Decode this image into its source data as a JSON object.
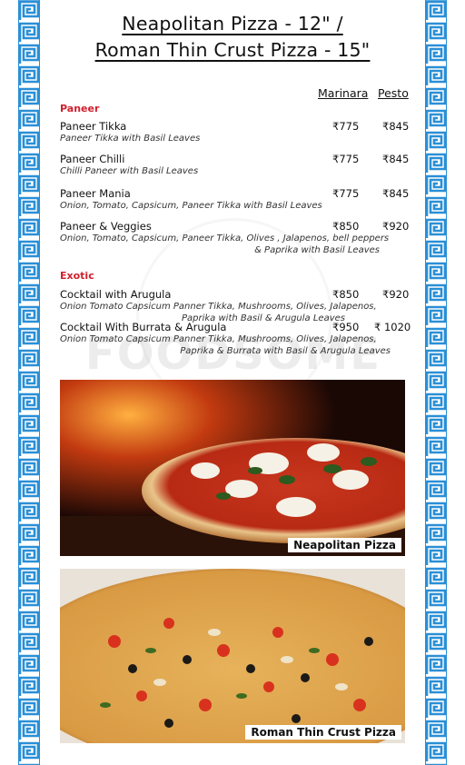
{
  "title_line1": "Neapolitan Pizza - 12\"  /",
  "title_line2": "Roman Thin Crust Pizza - 15\"",
  "columns": {
    "marinara": "Marinara",
    "pesto": "Pesto"
  },
  "sections": [
    {
      "name": "Paneer"
    },
    {
      "name": "Exotic"
    }
  ],
  "items": [
    {
      "name": "Paneer Tikka",
      "desc": "Paneer Tikka with Basil Leaves",
      "marinara": "₹775",
      "pesto": "₹845"
    },
    {
      "name": "Paneer Chilli",
      "desc": "Chilli Paneer with Basil Leaves",
      "marinara": "₹775",
      "pesto": "₹845"
    },
    {
      "name": "Paneer Mania",
      "desc": "Onion, Tomato, Capsicum, Paneer Tikka with Basil Leaves",
      "marinara": "₹775",
      "pesto": "₹845"
    },
    {
      "name": "Paneer & Veggies",
      "desc1": "Onion, Tomato, Capsicum, Paneer Tikka, Olives , Jalapenos, bell peppers",
      "desc2": "& Paprika with Basil Leaves",
      "marinara": "₹850",
      "pesto": "₹920"
    },
    {
      "name": "Cocktail with Arugula",
      "desc1": "Onion Tomato Capsicum Panner Tikka, Mushrooms, Olives, Jalapenos,",
      "desc2": "Paprika with Basil & Arugula Leaves",
      "marinara": "₹850",
      "pesto": "₹920"
    },
    {
      "name": "Cocktail With Burrata & Arugula",
      "desc1": "Onion Tomato Capsicum Panner Tikka, Mushrooms, Olives, Jalapenos,",
      "desc2": "Paprika & Burrata with Basil & Arugula Leaves",
      "marinara": "₹950",
      "pesto": "₹ 1020"
    }
  ],
  "watermark": "FOODSOME",
  "photos": [
    {
      "caption": "Neapolitan Pizza"
    },
    {
      "caption": "Roman Thin Crust Pizza"
    }
  ],
  "colors": {
    "border": "#2a8fd6",
    "section": "#d0202e"
  }
}
